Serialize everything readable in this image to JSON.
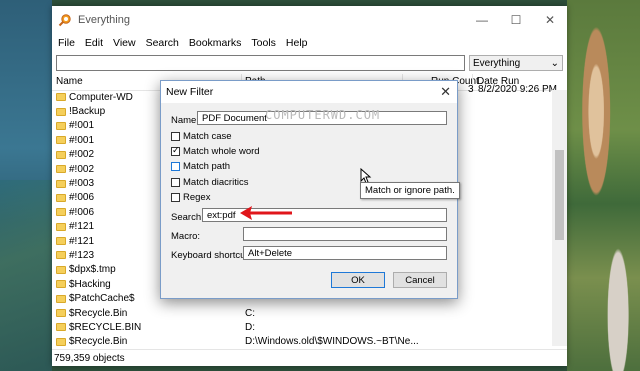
{
  "window": {
    "title": "Everything"
  },
  "menu": [
    "File",
    "Edit",
    "View",
    "Search",
    "Bookmarks",
    "Tools",
    "Help"
  ],
  "search": {
    "value": "",
    "filter": "Everything"
  },
  "columns": {
    "name": "Name",
    "path": "Path",
    "run_count": "Run Count",
    "date_run": "Date Run"
  },
  "top_row_extra": {
    "run_count": "3",
    "date_run": "8/2/2020 9:26 PM"
  },
  "rows": [
    {
      "name": "Computer-WD",
      "path": ""
    },
    {
      "name": "!Backup",
      "path": ""
    },
    {
      "name": "#!001",
      "path": ""
    },
    {
      "name": "#!001",
      "path": ""
    },
    {
      "name": "#!002",
      "path": ""
    },
    {
      "name": "#!002",
      "path": ""
    },
    {
      "name": "#!003",
      "path": ""
    },
    {
      "name": "#!006",
      "path": ""
    },
    {
      "name": "#!006",
      "path": ""
    },
    {
      "name": "#!121",
      "path": ""
    },
    {
      "name": "#!121",
      "path": ""
    },
    {
      "name": "#!123",
      "path": ""
    },
    {
      "name": "$dpx$.tmp",
      "path": ""
    },
    {
      "name": "$Hacking",
      "path": ""
    },
    {
      "name": "$PatchCache$",
      "path": ""
    },
    {
      "name": "$Recycle.Bin",
      "path": "C:"
    },
    {
      "name": "$RECYCLE.BIN",
      "path": "D:"
    },
    {
      "name": "$Recycle.Bin",
      "path": "D:\\Windows.old\\$WINDOWS.~BT\\Ne..."
    }
  ],
  "status": "759,359 objects",
  "dialog": {
    "title": "New Filter",
    "name_label": "Name:",
    "name_value": "PDF Document",
    "checkboxes": [
      {
        "label": "Match case",
        "checked": false
      },
      {
        "label": "Match whole word",
        "checked": true
      },
      {
        "label": "Match path",
        "checked": false
      },
      {
        "label": "Match diacritics",
        "checked": false
      },
      {
        "label": "Regex",
        "checked": false
      }
    ],
    "search_label": "Search:",
    "search_value": "ext:pdf",
    "macro_label": "Macro:",
    "macro_value": "",
    "shortcut_label": "Keyboard shortcut:",
    "shortcut_value": "Alt+Delete",
    "ok": "OK",
    "cancel": "Cancel",
    "tooltip": "Match or ignore path.",
    "watermark": "COMPUTERWD.COM"
  },
  "colors": {
    "accent": "#1e78d7",
    "arrow": "#e0161b",
    "folder": "#f5cf5b"
  }
}
